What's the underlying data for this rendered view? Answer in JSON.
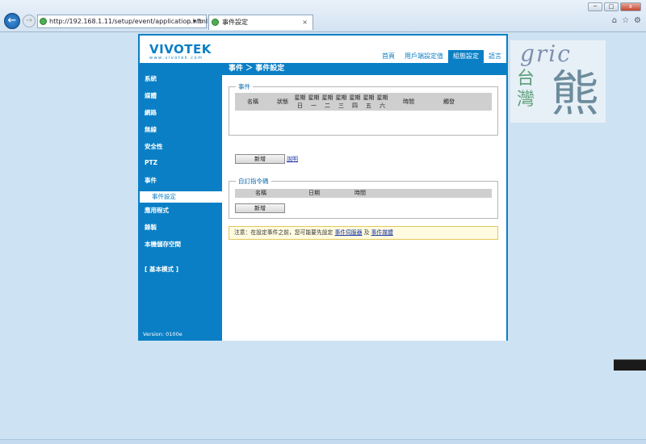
{
  "browser": {
    "url": "http://192.168.1.11/setup/event/application.html",
    "url_tools": "ρ ▾ ↻",
    "tab_title": "事件設定",
    "tab_close": "×",
    "win_min": "─",
    "win_max": "□",
    "win_close": "x",
    "right_icons": [
      "⌂",
      "☆",
      "⚙"
    ]
  },
  "logo": {
    "word": "VIVOTEK",
    "url": "www.vivotek.com"
  },
  "topnav": [
    {
      "label": "首頁",
      "active": false
    },
    {
      "label": "用戶端設定值",
      "active": false
    },
    {
      "label": "組態設定",
      "active": true
    },
    {
      "label": "語言",
      "active": false
    }
  ],
  "sidebar": {
    "items": [
      "系統",
      "媒體",
      "網路",
      "無線",
      "安全性",
      "PTZ",
      "事件",
      "應用程式",
      "錄製",
      "本機儲存空間"
    ],
    "sub_item": "事件設定",
    "basic_mode": "[ 基本模式 ]",
    "version": "Version: 0100e"
  },
  "page_title": "事件 ＞ 事件設定",
  "event_section": {
    "legend": "事件",
    "headers": [
      "名稱",
      "狀態",
      "星期日",
      "星期一",
      "星期二",
      "星期三",
      "星期四",
      "星期五",
      "星期六",
      "時間",
      "觸發"
    ],
    "add_button": "新增",
    "help_link": "說明"
  },
  "custom_section": {
    "legend": "自訂指令碼",
    "headers": [
      "名稱",
      "日期",
      "時間"
    ],
    "add_button": "新增"
  },
  "note": {
    "text": "注意：在設定事件之前，您可能要先設定",
    "link1": "事件伺服器",
    "and": "及",
    "link2": "事件媒體"
  },
  "watermark": {
    "gric": "gric",
    "tw1": "台",
    "tw2": "灣",
    "bear": "熊"
  },
  "colors": {
    "accent": "#0a7fc5",
    "note_bg": "#fffbe0",
    "desktop": "#cde3f4"
  }
}
